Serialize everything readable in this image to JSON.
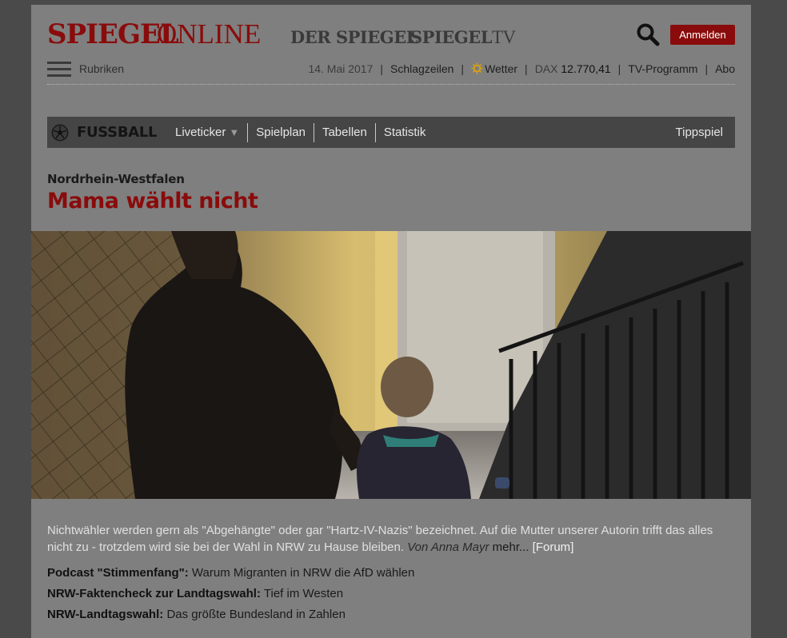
{
  "header": {
    "logo_spiegel": "SPIEGEL",
    "logo_online": "ONLINE",
    "logo_derspiegel": "DER SPIEGEL",
    "logo_spiegeltv_a": "SPIEGEL",
    "logo_spiegeltv_b": "TV",
    "login_label": "Anmelden"
  },
  "subnav": {
    "rubriken": "Rubriken",
    "date": "14. Mai 2017",
    "sep": "|",
    "schlagzeilen": "Schlagzeilen",
    "wetter": "Wetter",
    "dax_label": "DAX",
    "dax_value": "12.770,41",
    "tv": "TV-Programm",
    "abo": "Abo"
  },
  "fussball": {
    "title": "FUSSBALL",
    "liveticker": "Liveticker",
    "caret": "▼",
    "spielplan": "Spielplan",
    "tabellen": "Tabellen",
    "statistik": "Statistik",
    "tippspiel": "Tippspiel"
  },
  "article": {
    "kicker": "Nordrhein-Westfalen",
    "headline": "Mama wählt nicht",
    "teaser": "Nichtwähler werden gern als \"Abgehängte\" oder gar \"Hartz-IV-Nazis\" bezeichnet. Auf die Mutter unserer Autorin trifft das alles nicht zu - trotzdem wird sie bei der Wahl in NRW zu Hause bleiben.",
    "author": "Von Anna Mayr",
    "more": "mehr...",
    "forum_open": "[",
    "forum": "Forum",
    "forum_close": "]"
  },
  "related": [
    {
      "label": "Podcast \"Stimmenfang\":",
      "text": "Warum Migranten in NRW die AfD wählen"
    },
    {
      "label": "NRW-Faktencheck zur Landtagswahl:",
      "text": "Tief im Westen"
    },
    {
      "label": "NRW-Landtagswahl:",
      "text": "Das größte Bundesland in Zahlen"
    }
  ],
  "colors": {
    "brand_red": "#8a0b0b",
    "page_bg": "#7f7f7f",
    "outer_bg": "#4a4a4a",
    "fussball_bar": "#454545"
  }
}
